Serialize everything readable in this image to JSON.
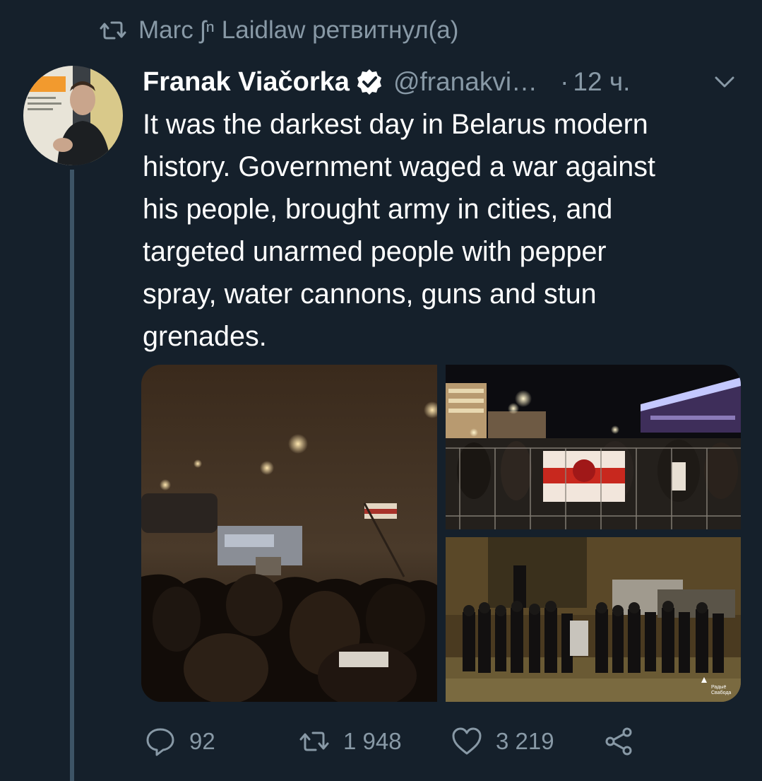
{
  "retweet": {
    "icon": "retweet-icon",
    "text": "Marc ʃⁿ Laidlaw ретвитнул(а)"
  },
  "tweet": {
    "author_name": "Franak Viačorka",
    "verified_icon": "verified-badge-icon",
    "handle": "@franakvi…",
    "separator": "·",
    "timestamp": "12 ч.",
    "menu_icon": "chevron-down-icon",
    "text": "It was the darkest day in Belarus modern\nhistory. Government waged a war against\nhis people, brought army in cities, and\ntargeted unarmed people with pepper\nspray, water cannons, guns and stun\ngrenades.",
    "photo3_watermark": "Радыё\nСвабода"
  },
  "actions": {
    "reply_count": "92",
    "retweet_count": "1 948",
    "like_count": "3 219",
    "icons": [
      "reply-icon",
      "retweet-icon",
      "like-icon",
      "share-icon"
    ]
  },
  "colors": {
    "background": "#15202b",
    "muted": "#8899a6",
    "thread_line": "#3d5466"
  }
}
